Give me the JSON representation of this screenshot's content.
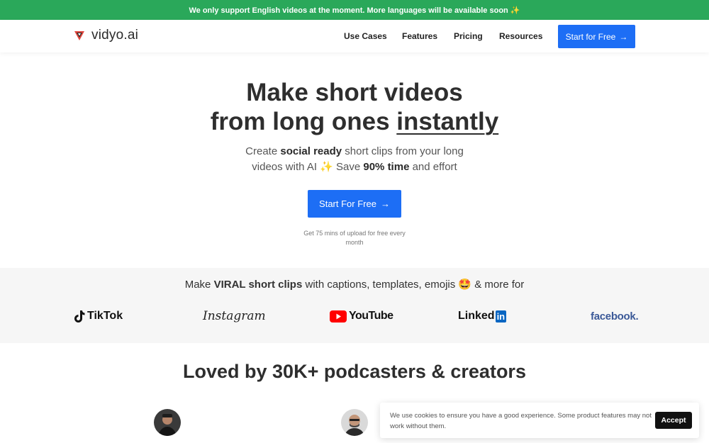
{
  "banner": {
    "text": "We only support English videos at the moment. More languages will be available soon ✨"
  },
  "nav": {
    "logo_text": "vidyo.ai",
    "links": [
      {
        "label": "Use Cases"
      },
      {
        "label": "Features"
      },
      {
        "label": "Pricing"
      },
      {
        "label": "Resources"
      }
    ],
    "cta_label": "Start for Free",
    "cta_arrow": "→"
  },
  "hero": {
    "title_line1": "Make short videos",
    "title_line2_pre": "from long ones ",
    "title_line2_emph": "instantly",
    "sub_a": "Create ",
    "sub_b": "social ready",
    "sub_c": " short clips from your long",
    "sub_d": "videos with AI ✨ Save ",
    "sub_e": "90% time",
    "sub_f": " and effort",
    "cta_label": "Start For Free",
    "cta_arrow": "→",
    "note": "Get 75 mins of upload for free every month"
  },
  "platforms": {
    "title_a": "Make ",
    "title_b": "VIRAL short clips",
    "title_c": " with captions, templates, emojis 🤩 & more for",
    "tiktok": "TikTok",
    "instagram": "Instagram",
    "youtube": "YouTube",
    "linkedin_a": "Linked",
    "linkedin_b": "in",
    "facebook": "facebook."
  },
  "social_proof": {
    "title": "Loved by 30K+ podcasters & creators"
  },
  "cookie": {
    "text": "We use cookies to ensure you have a good experience. Some product features may not work without them.",
    "accept_label": "Accept"
  },
  "colors": {
    "primary": "#1d6ef5",
    "banner": "#2aa85a",
    "logo_red": "#e2453c"
  },
  "icons": [
    "logo-icon",
    "arrow-right-icon",
    "tiktok-icon",
    "youtube-play-icon",
    "avatar"
  ]
}
